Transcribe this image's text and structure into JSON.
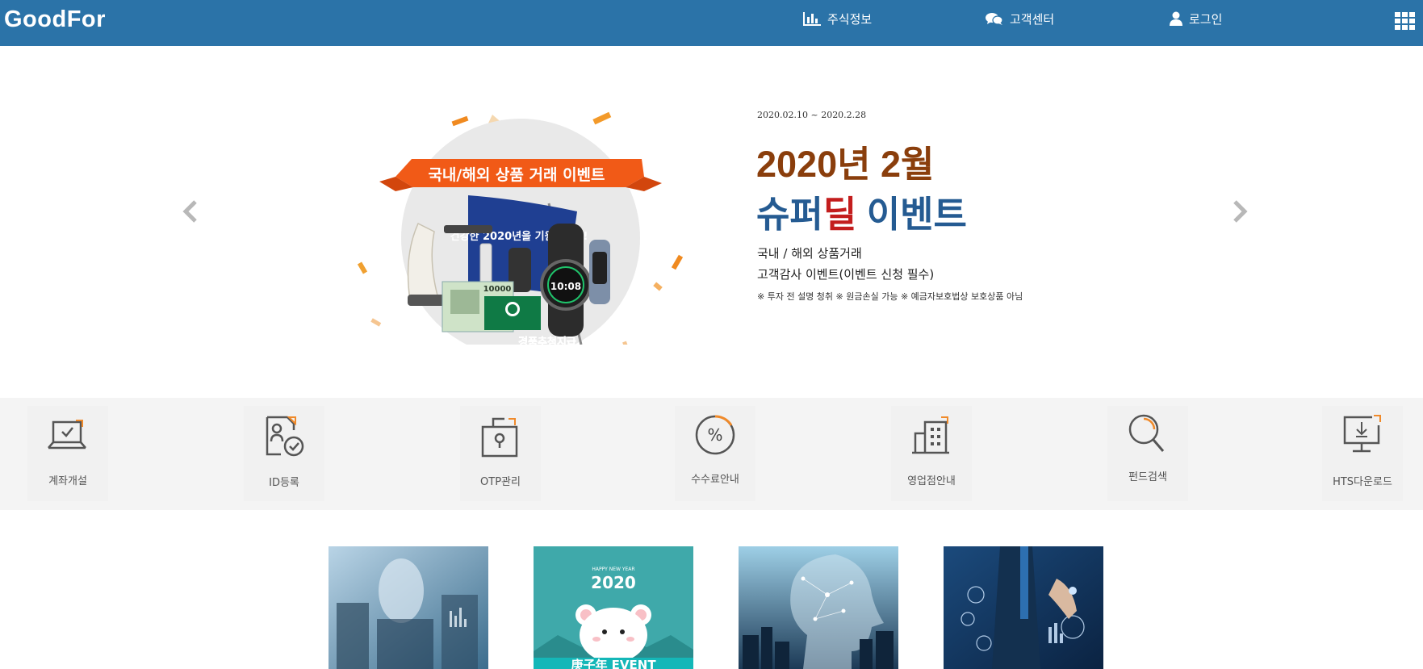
{
  "header": {
    "logo": "GoodFor",
    "nav": [
      {
        "label": "주식정보",
        "icon": "bar-chart-icon"
      },
      {
        "label": "고객센터",
        "icon": "chat-bubbles-icon"
      },
      {
        "label": "로그인",
        "icon": "user-icon"
      }
    ],
    "apps_icon": "grid-menu-icon"
  },
  "hero": {
    "period": "2020.02.10 ~ 2020.2.28",
    "title_line1": "2020년 2월",
    "title_line2_a": "슈퍼",
    "title_line2_highlight": "딜",
    "title_line2_b": " 이벤트",
    "desc1": "국내 / 해외 상품거래",
    "desc2": "고객감사 이벤트(이벤트 신청 필수)",
    "notice": "※ 투자 전 설명 청취 ※ 원금손실 가능 ※ 예금자보호법상 보호상품 아님",
    "banner": {
      "ribbon_text": "국내/해외 상품 거래 이벤트",
      "flag_text": "건강한 2020년을 기원합니다!",
      "watch_time": "10:08",
      "voucher_amount": "10000",
      "prize_text": "경품추첨지급"
    },
    "colors": {
      "title1": "#8a3e0c",
      "title2": "#255b92",
      "highlight": "#c31d1d"
    }
  },
  "quick_menu": [
    {
      "label": "계좌개설",
      "icon": "laptop-check-icon"
    },
    {
      "label": "ID등록",
      "icon": "id-register-icon"
    },
    {
      "label": "OTP관리",
      "icon": "otp-lock-icon"
    },
    {
      "label": "수수료안내",
      "icon": "percent-icon"
    },
    {
      "label": "영업점안내",
      "icon": "building-icon"
    },
    {
      "label": "펀드검색",
      "icon": "magnifier-icon"
    },
    {
      "label": "HTS다운로드",
      "icon": "monitor-download-icon"
    }
  ],
  "thumbnails": [
    {
      "name": "thumb-businessman-data",
      "text": ""
    },
    {
      "name": "thumb-new-year-event",
      "small_text": "HAPPY NEW YEAR",
      "year": "2020",
      "bottom_text": "庚子年 EVENT"
    },
    {
      "name": "thumb-ai-head",
      "text": ""
    },
    {
      "name": "thumb-hand-chart",
      "text": ""
    }
  ],
  "brand_color": "#2b73a8"
}
